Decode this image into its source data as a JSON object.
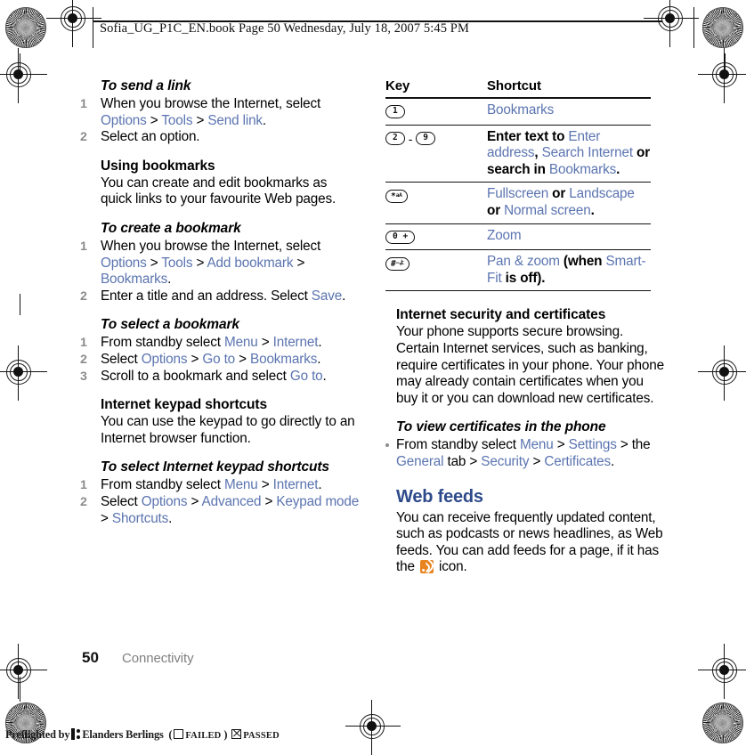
{
  "header": {
    "filename_line": "Sofia_UG_P1C_EN.book  Page 50  Wednesday, July 18, 2007  5:45 PM"
  },
  "colors": {
    "link_blue": "#5b74b0",
    "heading_blue": "#2d4a8a",
    "rss_orange": "#e98420",
    "number_gray": "#8c8c8c",
    "footer_gray": "#808080"
  },
  "left_column": {
    "s1_heading": "To send a link",
    "s1_steps": [
      {
        "num": "1",
        "a": "When you browse the Internet, select ",
        "l1": "Options",
        "g1": " > ",
        "l2": "Tools",
        "g2": " > ",
        "l3": "Send link",
        "tail": "."
      },
      {
        "num": "2",
        "a": "Select an option.",
        "l1": "",
        "g1": "",
        "l2": "",
        "g2": "",
        "l3": "",
        "tail": ""
      }
    ],
    "s2_heading": "Using bookmarks",
    "s2_body": "You can create and edit bookmarks as quick links to your favourite Web pages.",
    "s3_heading": "To create a bookmark",
    "s3_step1": {
      "num": "1",
      "a": "When you browse the Internet, select ",
      "l1": "Options",
      "g1": " > ",
      "l2": "Tools",
      "g2": " > ",
      "l3": "Add bookmark",
      "g3": " > ",
      "l4": "Bookmarks",
      "tail": "."
    },
    "s3_step2": {
      "num": "2",
      "a": "Enter a title and an address. Select ",
      "l1": "Save",
      "tail": "."
    },
    "s4_heading": "To select a bookmark",
    "s4_step1": {
      "num": "1",
      "a": "From standby select ",
      "l1": "Menu",
      "g1": " > ",
      "l2": "Internet",
      "tail": "."
    },
    "s4_step2": {
      "num": "2",
      "a": "Select ",
      "l1": "Options",
      "g1": " > ",
      "l2": "Go to",
      "g2": " > ",
      "l3": "Bookmarks",
      "tail": "."
    },
    "s4_step3": {
      "num": "3",
      "a": "Scroll to a bookmark and select ",
      "l1": "Go to",
      "tail": "."
    },
    "s5_heading": "Internet keypad shortcuts",
    "s5_body": "You can use the keypad to go directly to an Internet browser function.",
    "s6_heading": "To select Internet keypad shortcuts",
    "s6_step1": {
      "num": "1",
      "a": "From standby select ",
      "l1": "Menu",
      "g1": " > ",
      "l2": "Internet",
      "tail": "."
    },
    "s6_step2": {
      "num": "2",
      "a": "Select ",
      "l1": "Options",
      "g1": " > ",
      "l2": "Advanced",
      "g2": " > ",
      "l3": "Keypad mode",
      "g3": " > ",
      "l4": "Shortcuts",
      "tail": "."
    }
  },
  "table": {
    "headers": {
      "key": "Key",
      "shortcut": "Shortcut"
    },
    "rows": [
      {
        "key_icon": "key-1-icon",
        "key_label": "1",
        "key_label2": "",
        "shortcut_parts": [
          {
            "t": "Bookmarks",
            "s": "link"
          }
        ]
      },
      {
        "key_icon": "key-2-to-9-range-icon",
        "key_label": "2",
        "key_label2": "9",
        "range_dash": "-",
        "shortcut_parts": [
          {
            "t": "Enter text to ",
            "s": "bold"
          },
          {
            "t": "Enter address",
            "s": "link"
          },
          {
            "t": ", ",
            "s": "bold"
          },
          {
            "t": "Search Internet",
            "s": "link"
          },
          {
            "t": " or search in ",
            "s": "bold"
          },
          {
            "t": "Bookmarks",
            "s": "link"
          },
          {
            "t": ".",
            "s": "bold"
          }
        ]
      },
      {
        "key_icon": "key-asterisk-icon",
        "key_label": "*",
        "key_label2": "",
        "key_sub": "aA",
        "shortcut_parts": [
          {
            "t": "Fullscreen",
            "s": "link"
          },
          {
            "t": " or ",
            "s": "bold"
          },
          {
            "t": "Landscape",
            "s": "link"
          },
          {
            "t": " or ",
            "s": "bold"
          },
          {
            "t": "Normal screen",
            "s": "link"
          },
          {
            "t": ".",
            "s": "bold"
          }
        ]
      },
      {
        "key_icon": "key-0-icon",
        "key_label": "0 +",
        "key_label2": "",
        "shortcut_parts": [
          {
            "t": "Zoom",
            "s": "link"
          }
        ]
      },
      {
        "key_icon": "key-hash-icon",
        "key_label": "#",
        "key_label2": "",
        "shortcut_parts": [
          {
            "t": "Pan & zoom",
            "s": "link"
          },
          {
            "t": " (when ",
            "s": "bold"
          },
          {
            "t": "Smart-Fit",
            "s": "link"
          },
          {
            "t": " is off).",
            "s": "bold"
          }
        ]
      }
    ]
  },
  "right_column": {
    "sec_heading": "Internet security and certificates",
    "sec_body": "Your phone supports secure browsing. Certain Internet services, such as banking, require certificates in your phone. Your phone may already contain certificates when you buy it or you can download new certificates.",
    "cert_heading": "To view certificates in the phone",
    "cert_step": {
      "a": "From standby select ",
      "l1": "Menu",
      "g1": " > ",
      "l2": "Settings",
      "g2": " > the ",
      "l3": "General",
      "g3": " tab > ",
      "l4": "Security",
      "g4": " > ",
      "l5": "Certificates",
      "tail": "."
    },
    "feeds_heading": "Web feeds",
    "feeds_body_1": "You can receive frequently updated content, such as podcasts or news headlines, as Web feeds. You can add feeds for a page, if it has the ",
    "feeds_icon_name": "rss-feed-icon",
    "feeds_body_2": " icon."
  },
  "footer": {
    "page_number": "50",
    "section": "Connectivity"
  },
  "preflight": {
    "prefix": "Preflighted by",
    "company": "Elanders Berlings",
    "open_paren": "(",
    "failed_label": "FAILED",
    "close_paren": ")",
    "passed_label": "PASSED"
  }
}
